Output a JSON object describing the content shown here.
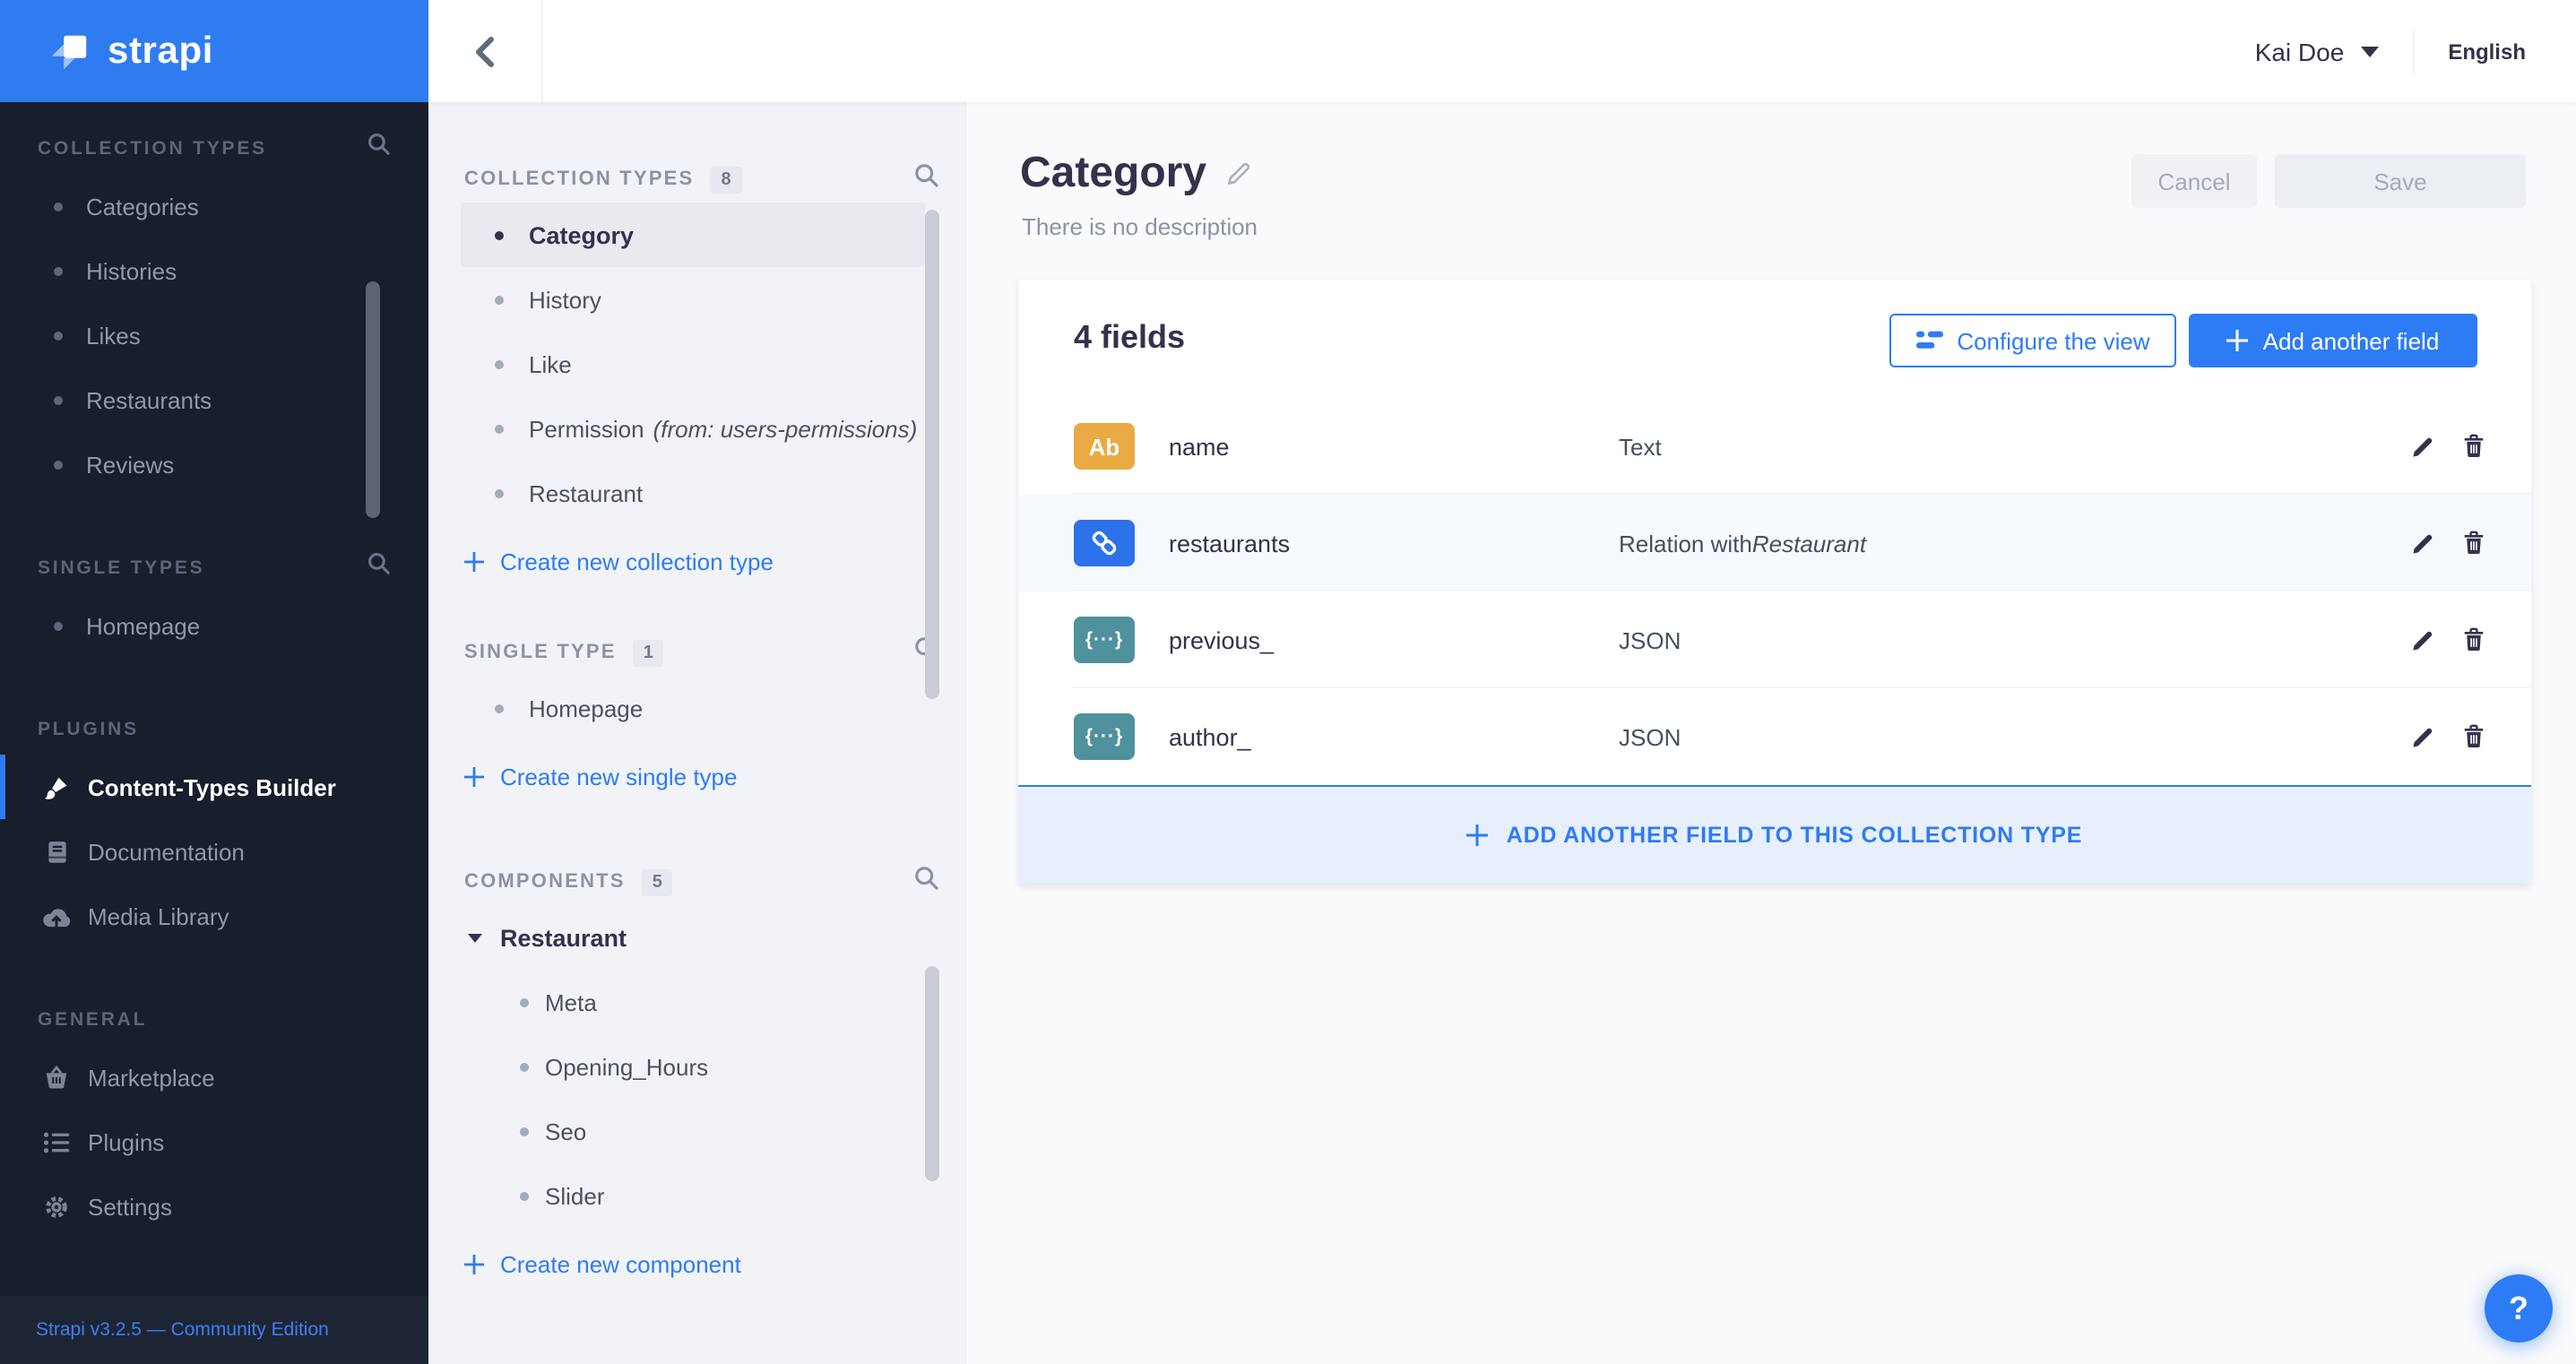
{
  "colors": {
    "brand_blue": "#2f7cf0",
    "accent_blue": "#2d7cf5",
    "sidebar_bg": "#181e2c",
    "badge_text_field": "#e9aa43",
    "badge_relation": "#2d72ea",
    "badge_json": "#4f919d",
    "add_row_bg": "#e8effc"
  },
  "brand": {
    "logo_text": "strapi"
  },
  "topbar": {
    "user_name": "Kai Doe",
    "language": "English"
  },
  "sidebar": {
    "sections": [
      {
        "title": "COLLECTION TYPES",
        "items": [
          {
            "label": "Categories"
          },
          {
            "label": "Histories"
          },
          {
            "label": "Likes"
          },
          {
            "label": "Restaurants"
          },
          {
            "label": "Reviews"
          }
        ]
      },
      {
        "title": "SINGLE TYPES",
        "items": [
          {
            "label": "Homepage"
          }
        ]
      },
      {
        "title": "PLUGINS",
        "items": [
          {
            "label": "Content-Types Builder",
            "icon": "paintbrush-icon"
          },
          {
            "label": "Documentation",
            "icon": "book-icon"
          },
          {
            "label": "Media Library",
            "icon": "cloud-upload-icon"
          }
        ]
      },
      {
        "title": "GENERAL",
        "items": [
          {
            "label": "Marketplace",
            "icon": "basket-icon"
          },
          {
            "label": "Plugins",
            "icon": "list-icon"
          },
          {
            "label": "Settings",
            "icon": "gear-icon"
          }
        ]
      }
    ],
    "footer_version": "Strapi v3.2.5 — Community Edition"
  },
  "subpanel": {
    "collection_types": {
      "title": "COLLECTION TYPES",
      "count": "8",
      "items": [
        {
          "label": "Category"
        },
        {
          "label": "History"
        },
        {
          "label": "Like"
        },
        {
          "label": "Permission",
          "note": "(from: users-permissions)"
        },
        {
          "label": "Restaurant"
        }
      ],
      "create_label": "Create new collection type"
    },
    "single_type": {
      "title": "SINGLE TYPE",
      "count": "1",
      "items": [
        {
          "label": "Homepage"
        }
      ],
      "create_label": "Create new single type"
    },
    "components": {
      "title": "COMPONENTS",
      "count": "5",
      "group_label": "Restaurant",
      "items": [
        {
          "label": "Meta"
        },
        {
          "label": "Opening_Hours"
        },
        {
          "label": "Seo"
        },
        {
          "label": "Slider"
        }
      ],
      "create_label": "Create new component"
    }
  },
  "main": {
    "title": "Category",
    "description": "There is no description",
    "cancel_label": "Cancel",
    "save_label": "Save",
    "fields_heading": "4 fields",
    "configure_view_label": "Configure the view",
    "add_field_label": "Add another field",
    "fields": [
      {
        "name": "name",
        "type": "Text",
        "badge_label": "Ab",
        "icon": "text-field-icon"
      },
      {
        "name": "restaurants",
        "type": "Relation with ",
        "type_target": "Restaurant",
        "icon": "relation-link-icon"
      },
      {
        "name": "previous_",
        "type": "JSON",
        "badge_label": "{···}",
        "icon": "json-icon"
      },
      {
        "name": "author_",
        "type": "JSON",
        "badge_label": "{···}",
        "icon": "json-icon"
      }
    ],
    "add_row_label": "ADD ANOTHER FIELD TO THIS COLLECTION TYPE",
    "help_label": "?"
  }
}
